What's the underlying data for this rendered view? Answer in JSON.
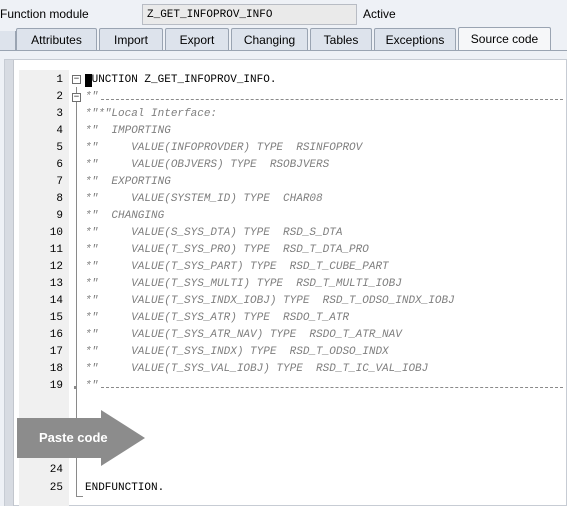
{
  "header": {
    "label": "Function module",
    "value": "Z_GET_INFOPROV_INFO",
    "status": "Active"
  },
  "tabs": [
    {
      "label": "Attributes"
    },
    {
      "label": "Import"
    },
    {
      "label": "Export"
    },
    {
      "label": "Changing"
    },
    {
      "label": "Tables"
    },
    {
      "label": "Exceptions"
    },
    {
      "label": "Source code",
      "active": true
    }
  ],
  "editor": {
    "lines": [
      {
        "n": "1",
        "text": "FUNCTION Z_GET_INFOPROV_INFO.",
        "type": "code"
      },
      {
        "n": "2",
        "text": "*\"",
        "type": "comment"
      },
      {
        "n": "3",
        "text": "*\"*\"Local Interface:",
        "type": "comment"
      },
      {
        "n": "4",
        "text": "*\"  IMPORTING",
        "type": "comment"
      },
      {
        "n": "5",
        "text": "*\"     VALUE(INFOPROVDER) TYPE  RSINFOPROV",
        "type": "comment"
      },
      {
        "n": "6",
        "text": "*\"     VALUE(OBJVERS) TYPE  RSOBJVERS",
        "type": "comment"
      },
      {
        "n": "7",
        "text": "*\"  EXPORTING",
        "type": "comment"
      },
      {
        "n": "8",
        "text": "*\"     VALUE(SYSTEM_ID) TYPE  CHAR08",
        "type": "comment"
      },
      {
        "n": "9",
        "text": "*\"  CHANGING",
        "type": "comment"
      },
      {
        "n": "10",
        "text": "*\"     VALUE(S_SYS_DTA) TYPE  RSD_S_DTA",
        "type": "comment"
      },
      {
        "n": "11",
        "text": "*\"     VALUE(T_SYS_PRO) TYPE  RSD_T_DTA_PRO",
        "type": "comment"
      },
      {
        "n": "12",
        "text": "*\"     VALUE(T_SYS_PART) TYPE  RSD_T_CUBE_PART",
        "type": "comment"
      },
      {
        "n": "13",
        "text": "*\"     VALUE(T_SYS_MULTI) TYPE  RSD_T_MULTI_IOBJ",
        "type": "comment"
      },
      {
        "n": "14",
        "text": "*\"     VALUE(T_SYS_INDX_IOBJ) TYPE  RSD_T_ODSO_INDX_IOBJ",
        "type": "comment"
      },
      {
        "n": "15",
        "text": "*\"     VALUE(T_SYS_ATR) TYPE  RSDO_T_ATR",
        "type": "comment"
      },
      {
        "n": "16",
        "text": "*\"     VALUE(T_SYS_ATR_NAV) TYPE  RSDO_T_ATR_NAV",
        "type": "comment"
      },
      {
        "n": "17",
        "text": "*\"     VALUE(T_SYS_INDX) TYPE  RSD_T_ODSO_INDX",
        "type": "comment"
      },
      {
        "n": "18",
        "text": "*\"     VALUE(T_SYS_VAL_IOBJ) TYPE  RSD_T_IC_VAL_IOBJ",
        "type": "comment"
      },
      {
        "n": "19",
        "text": "*\"",
        "type": "comment"
      },
      {
        "n": "24",
        "text": "",
        "type": "code"
      },
      {
        "n": "25",
        "text": "ENDFUNCTION.",
        "type": "code"
      }
    ]
  },
  "overlay": {
    "label": "Paste code",
    "color": "#8c8c8c"
  },
  "icons": {
    "fold_expanded": "minus-box-icon",
    "fold_collapsed": "plus-box-icon"
  }
}
